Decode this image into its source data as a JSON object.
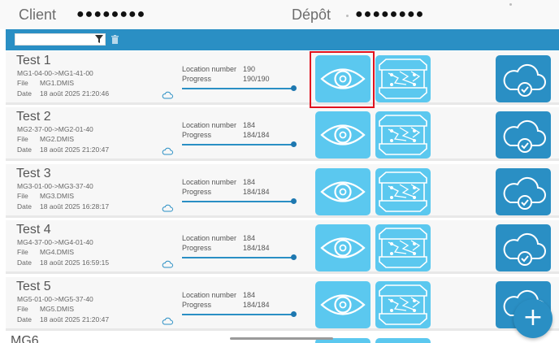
{
  "header": {
    "client_label": "Client",
    "client_value": "●●●●●●●●",
    "depot_label": "Dépôt",
    "depot_value": "●●●●●●●●"
  },
  "search": {
    "value": "",
    "placeholder": ""
  },
  "colors": {
    "accent": "#2a8fc4",
    "tile_light": "#5bc8ef",
    "highlight": "#e0121e"
  },
  "rows": [
    {
      "title": "Test 1",
      "route": "MG1-04-00->MG1-41-00",
      "file_label": "File",
      "file": "MG1.DMIS",
      "date_label": "Date",
      "date": "18 août 2025 21:20:46",
      "location_label": "Location number",
      "location": "190",
      "progress_label": "Progress",
      "progress": "190/190",
      "progress_fraction": 1.0
    },
    {
      "title": "Test 2",
      "route": "MG2-37-00->MG2-01-40",
      "file_label": "File",
      "file": "MG2.DMIS",
      "date_label": "Date",
      "date": "18 août 2025 21:20:47",
      "location_label": "Location number",
      "location": "184",
      "progress_label": "Progress",
      "progress": "184/184",
      "progress_fraction": 1.0
    },
    {
      "title": "Test 3",
      "route": "MG3-01-00->MG3-37-40",
      "file_label": "File",
      "file": "MG3.DMIS",
      "date_label": "Date",
      "date": "18 août 2025 16:28:17",
      "location_label": "Location number",
      "location": "184",
      "progress_label": "Progress",
      "progress": "184/184",
      "progress_fraction": 1.0
    },
    {
      "title": "Test 4",
      "route": "MG4-37-00->MG4-01-40",
      "file_label": "File",
      "file": "MG4.DMIS",
      "date_label": "Date",
      "date": "18 août 2025 16:59:15",
      "location_label": "Location number",
      "location": "184",
      "progress_label": "Progress",
      "progress": "184/184",
      "progress_fraction": 1.0
    },
    {
      "title": "Test 5",
      "route": "MG5-01-00->MG5-37-40",
      "file_label": "File",
      "file": "MG5.DMIS",
      "date_label": "Date",
      "date": "18 août 2025 21:20:47",
      "location_label": "Location number",
      "location": "184",
      "progress_label": "Progress",
      "progress": "184/184",
      "progress_fraction": 1.0
    }
  ],
  "partial_row_title": "MG6",
  "fab_label": "+",
  "icons": {
    "view": "eye-icon",
    "part": "part-scan-icon",
    "sync": "cloud-check-icon",
    "filter": "filter-icon",
    "trash": "trash-icon",
    "add": "plus-icon"
  }
}
